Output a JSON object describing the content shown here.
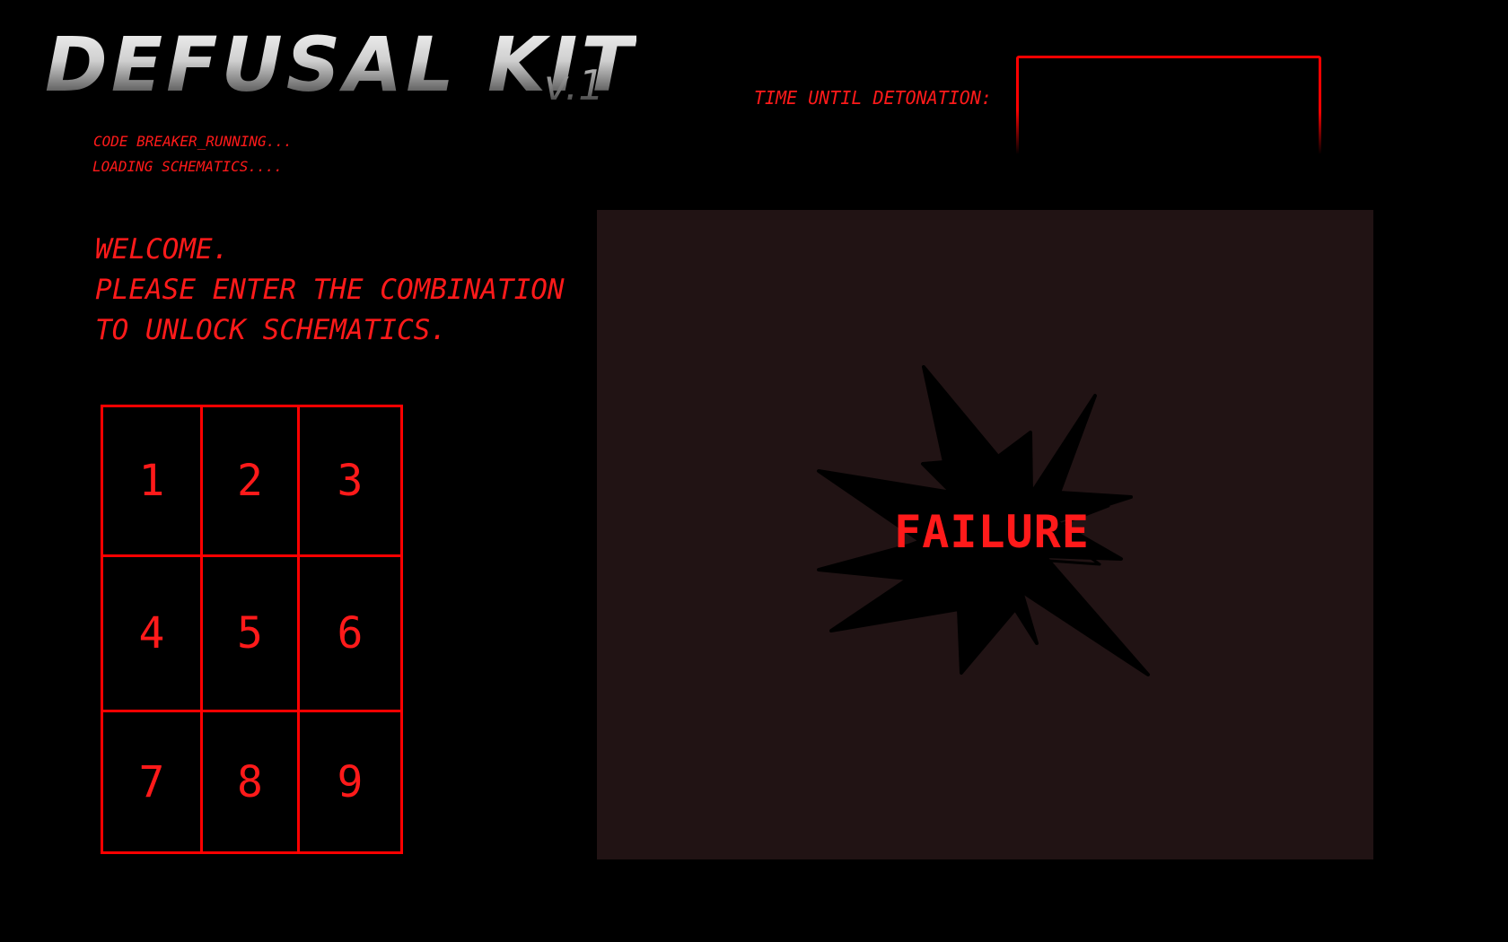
{
  "header": {
    "title": "DEFUSAL KIT",
    "version": "v.1",
    "status_lines": [
      "CODE BREAKER_RUNNING...",
      "LOADING SCHEMATICS...."
    ]
  },
  "timer": {
    "label": "TIME UNTIL DETONATION:",
    "value": ""
  },
  "welcome": {
    "lines": [
      "WELCOME.",
      "PLEASE ENTER THE COMBINATION",
      "TO UNLOCK SCHEMATICS."
    ]
  },
  "keypad": {
    "keys": [
      "1",
      "2",
      "3",
      "4",
      "5",
      "6",
      "7",
      "8",
      "9"
    ]
  },
  "schematic_panel": {
    "result_text": "FAILURE",
    "icon": "explosion-icon"
  },
  "colors": {
    "accent": "#ff0000",
    "panel_bg": "#211314",
    "background": "#000000"
  }
}
